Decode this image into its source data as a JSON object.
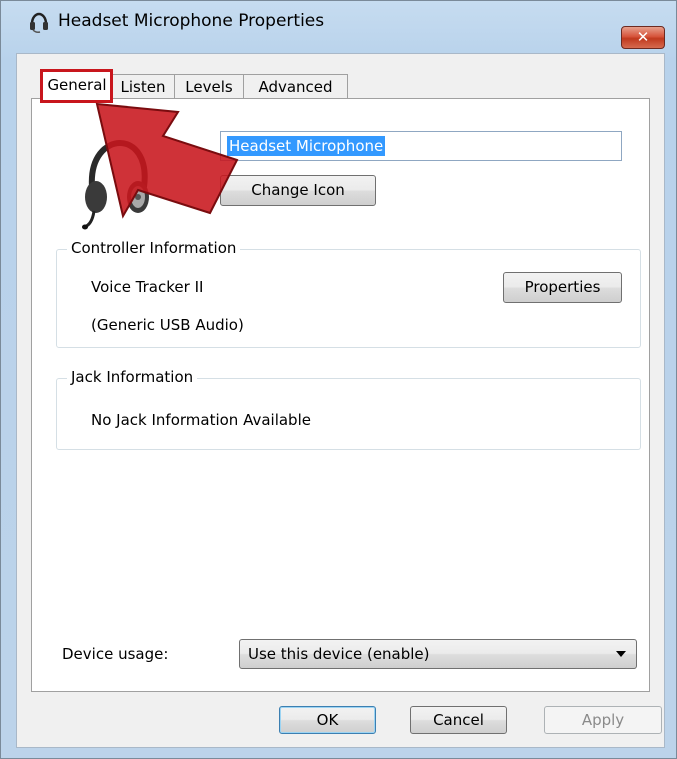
{
  "window": {
    "title": "Headset Microphone Properties",
    "close_icon": "close-icon",
    "title_icon": "headset-icon"
  },
  "tabs": [
    {
      "label": "General",
      "active": true
    },
    {
      "label": "Listen",
      "active": false
    },
    {
      "label": "Levels",
      "active": false
    },
    {
      "label": "Advanced",
      "active": false
    }
  ],
  "general": {
    "device_name": "Headset Microphone",
    "change_icon_label": "Change Icon",
    "device_icon": "headset-icon",
    "controller": {
      "title": "Controller Information",
      "name": "Voice Tracker II",
      "driver": "(Generic USB Audio)",
      "properties_label": "Properties"
    },
    "jack": {
      "title": "Jack Information",
      "text": "No Jack Information Available"
    },
    "device_usage": {
      "label": "Device usage:",
      "selected": "Use this device (enable)"
    }
  },
  "footer": {
    "ok_label": "OK",
    "cancel_label": "Cancel",
    "apply_label": "Apply"
  },
  "annotation": {
    "highlight_color": "#c8161d",
    "arrow_color": "#c8161d"
  }
}
